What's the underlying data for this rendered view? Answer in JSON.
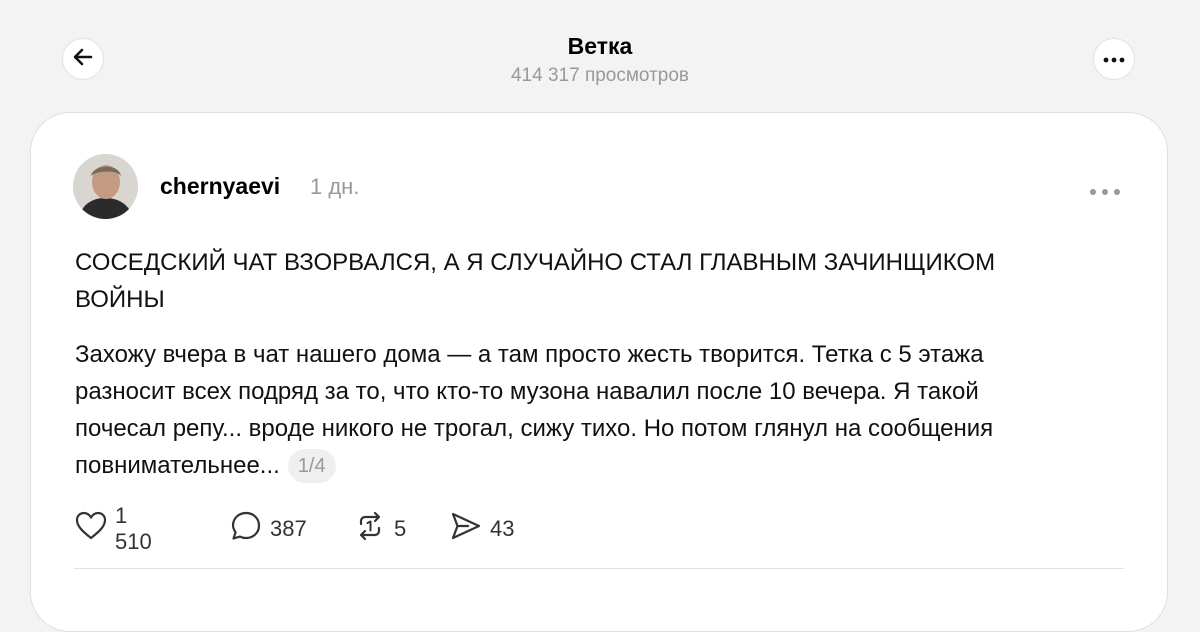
{
  "header": {
    "title": "Ветка",
    "views": "414 317 просмотров"
  },
  "icons": {
    "back": "arrow-left-icon",
    "menu": "more-horizontal-icon"
  },
  "post": {
    "username": "chernyaevi",
    "time": "1 дн.",
    "title": "СОСЕДСКИЙ ЧАТ ВЗОРВАЛСЯ, А Я СЛУЧАЙНО СТАЛ ГЛАВНЫМ ЗАЧИНЩИКОМ ВОЙНЫ",
    "body": "Захожу вчера в чат нашего дома — а там просто жесть творится. Тетка с 5 этажа разносит всех подряд за то, что кто-то музона навалил после 10 вечера. Я такой почесал репу... вроде никого не трогал, сижу тихо. Но потом глянул на сообщения повнимательнее...",
    "page_indicator": "1/4",
    "actions": {
      "likes": "1 510",
      "comments": "387",
      "reposts": "5",
      "shares": "43"
    }
  }
}
